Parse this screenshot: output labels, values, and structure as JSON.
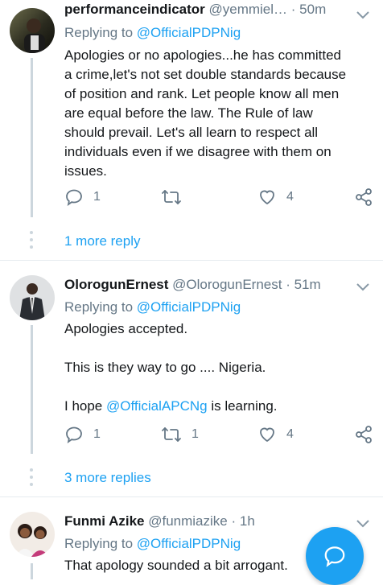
{
  "tweets": [
    {
      "name": "performanceindicator",
      "handle": "@yemmiel…",
      "time": "· 50m",
      "replying_prefix": "Replying to ",
      "replying_to": "@OfficialPDPNig",
      "text_lines": [
        "Apologies or no apologies...he has committed",
        "a crime,let's not set double standards because",
        "of position and rank. Let people know all men",
        "are equal before the law. The Rule of law",
        "should prevail. Let's all learn to respect all",
        "individuals even if we disagree with them on",
        "issues."
      ],
      "replies": "1",
      "retweets": "",
      "likes": "4",
      "more_replies": "1 more reply"
    },
    {
      "name": "OlorogunErnest",
      "handle": "@OlorogunErnest",
      "time": "· 51m",
      "replying_prefix": "Replying to ",
      "replying_to": "@OfficialPDPNig",
      "text_lines": [
        "Apologies accepted.",
        "This is they way to go .... Nigeria."
      ],
      "text_prefix": "I hope ",
      "text_mention": "@OfficialAPCNg",
      "text_suffix": " is learning.",
      "replies": "1",
      "retweets": "1",
      "likes": "4",
      "more_replies": "3 more replies"
    },
    {
      "name": "Funmi Azike",
      "handle": "@funmiazike",
      "time": "· 1h",
      "replying_prefix": "Replying to ",
      "replying_to": "@OfficialPDPNig",
      "text_lines": [
        "That apology sounded a bit arrogant."
      ]
    }
  ],
  "icons": {
    "reply": "reply-icon",
    "retweet": "retweet-icon",
    "like": "heart-icon",
    "share": "share-icon",
    "menu": "chevron-down-icon",
    "compose": "compose-reply-icon"
  },
  "colors": {
    "accent": "#1da1f2",
    "secondary_text": "#657786",
    "divider": "#e6ecf0"
  }
}
